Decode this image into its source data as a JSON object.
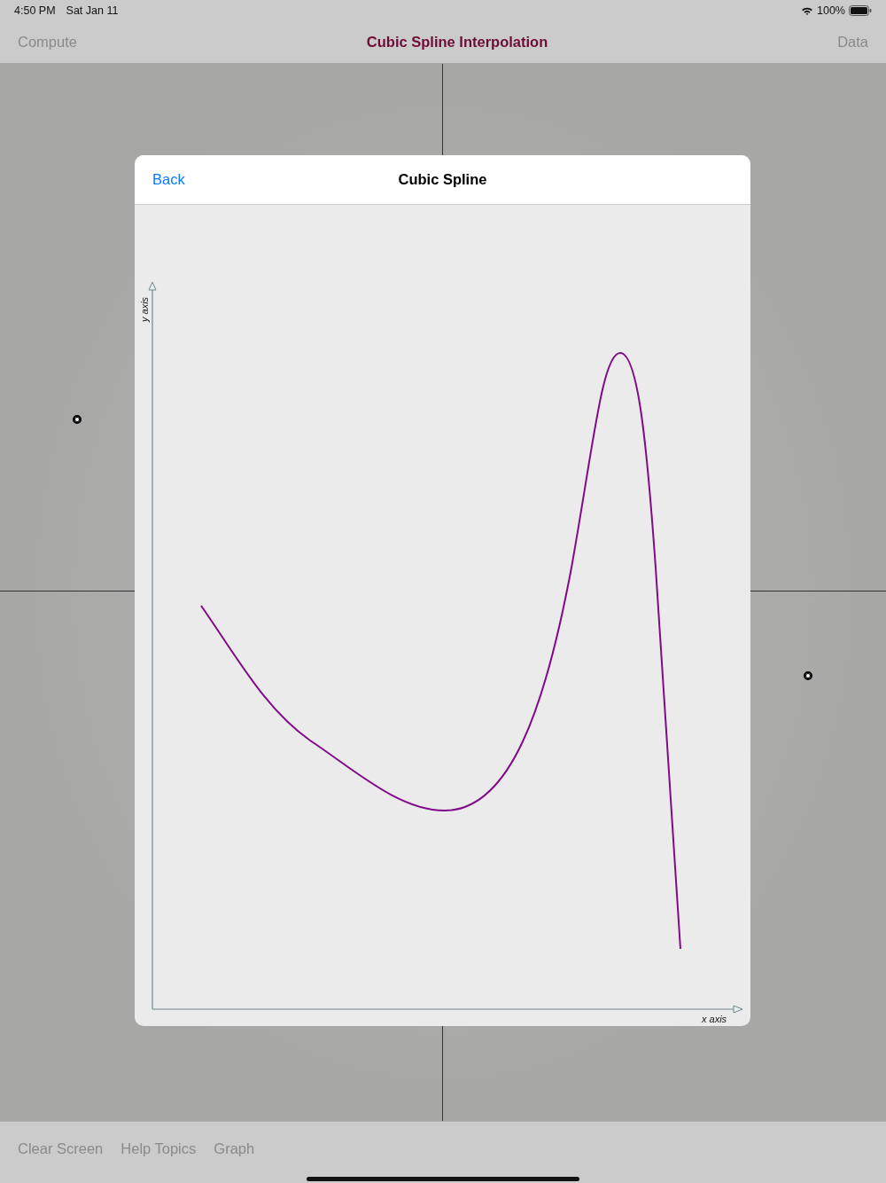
{
  "status_bar": {
    "time": "4:50 PM",
    "date": "Sat Jan 11",
    "battery": "100%"
  },
  "nav_bar": {
    "left": "Compute",
    "title": "Cubic Spline Interpolation",
    "right": "Data"
  },
  "dialog": {
    "back": "Back",
    "title": "Cubic Spline",
    "x_label": "x axis",
    "y_label": "y axis"
  },
  "toolbar": [
    "Clear Screen",
    "Help Topics",
    "Graph"
  ]
}
